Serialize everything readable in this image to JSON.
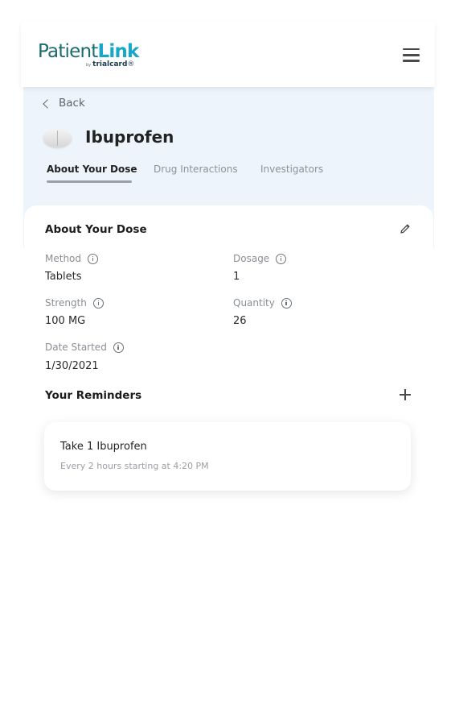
{
  "header": {
    "logo_patient": "Patient",
    "logo_link": "Link",
    "logo_by": "by",
    "logo_brand": "trialcard",
    "logo_tm": "®",
    "menu_icon": "hamburger-menu-icon"
  },
  "nav": {
    "back_label": "Back",
    "back_icon": "chevron-left-icon"
  },
  "drug": {
    "name": "Ibuprofen",
    "icon": "pill-icon"
  },
  "tabs": [
    {
      "label": "About Your Dose",
      "active": true
    },
    {
      "label": "Drug Interactions",
      "active": false
    },
    {
      "label": "Investigators",
      "active": false
    }
  ],
  "dose": {
    "section_title": "About Your Dose",
    "edit_icon": "pencil-icon",
    "fields": {
      "method": {
        "label": "Method",
        "value": "Tablets"
      },
      "dosage": {
        "label": "Dosage",
        "value": "1"
      },
      "strength": {
        "label": "Strength",
        "value": "100 MG"
      },
      "quantity": {
        "label": "Quantity",
        "value": "26"
      },
      "date_started": {
        "label": "Date Started",
        "value": "1/30/2021"
      }
    },
    "info_icon": "info-circle-icon"
  },
  "reminders": {
    "section_title": "Your Reminders",
    "add_icon": "plus-icon",
    "items": [
      {
        "title": "Take 1 Ibuprofen",
        "subtitle": "Every 2 hours starting at 4:20 PM"
      }
    ]
  },
  "colors": {
    "brand_teal": "#1b6b6f",
    "brand_blue": "#18a6c9",
    "band_bg": "#eef4fb"
  }
}
